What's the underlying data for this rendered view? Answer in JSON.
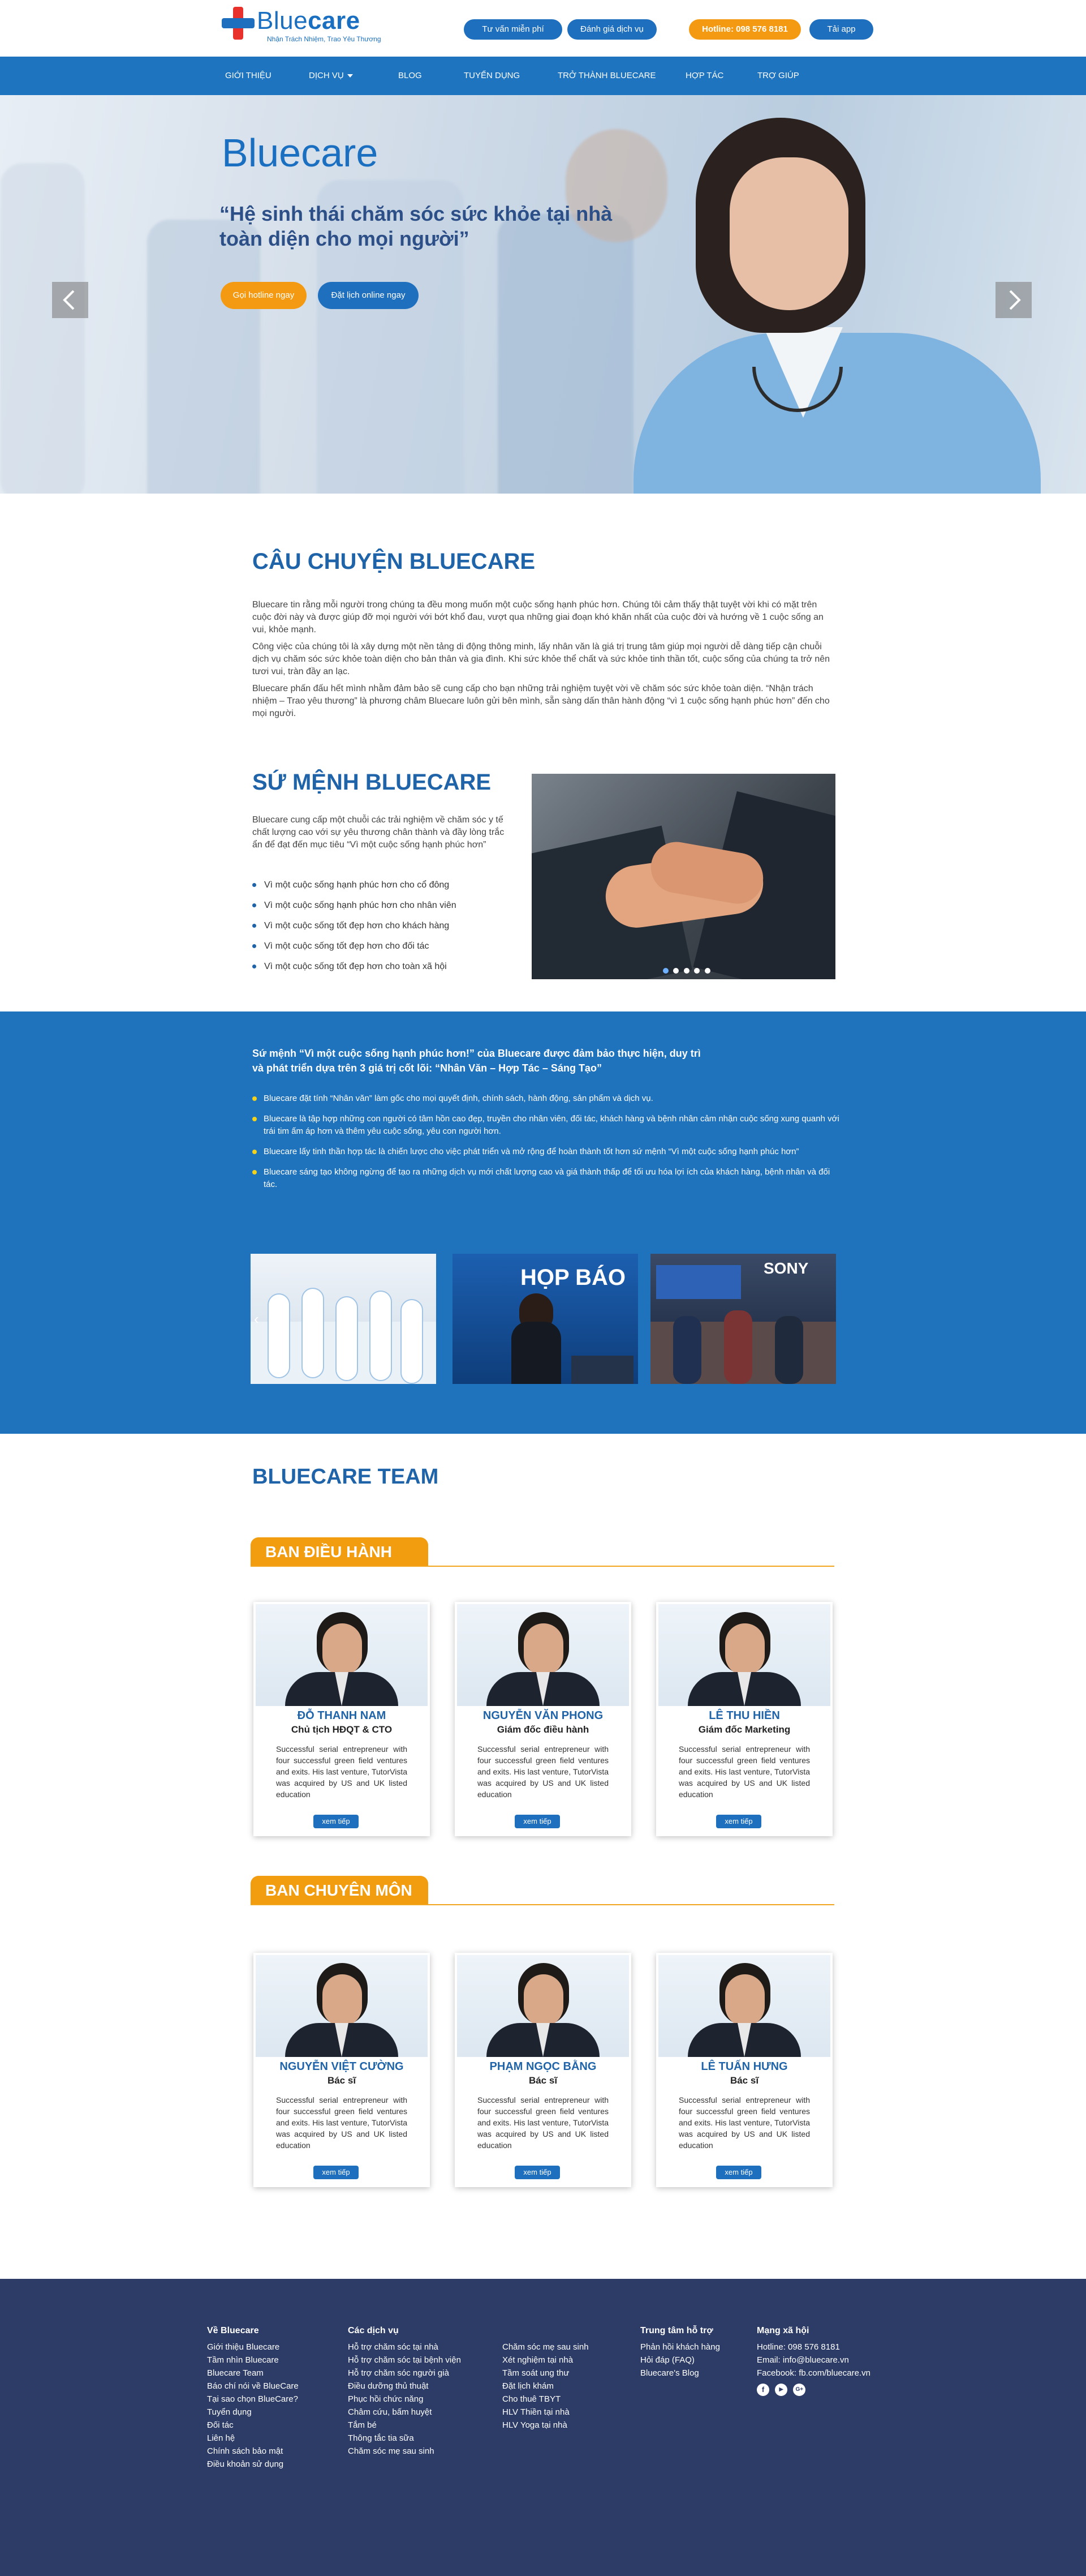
{
  "header": {
    "logo_word_light": "Blue",
    "logo_word_bold": "care",
    "tagline": "Nhận Trách Nhiệm, Trao Yêu Thương",
    "btn_consult": "Tư vấn miễn phí",
    "btn_review": "Đánh giá dịch vụ",
    "hotline": "Hotline: 098 576 8181",
    "btn_app": "Tải app"
  },
  "nav": {
    "items": [
      "GIỚI THIỆU",
      "DỊCH VỤ",
      "BLOG",
      "TUYỂN DỤNG",
      "TRỞ THÀNH BLUECARE",
      "HỢP TÁC",
      "TRỢ GIÚP"
    ]
  },
  "hero": {
    "logo": "Bluecare",
    "quote": "“Hệ sinh thái chăm sóc sức khỏe tại nhà toàn diện cho mọi người”",
    "btn_hotline": "Gọi hotline ngay",
    "btn_booking": "Đặt lịch online ngay"
  },
  "story": {
    "title": "CÂU CHUYỆN BLUECARE",
    "paragraphs": [
      "Bluecare tin rằng mỗi người trong chúng ta đều mong muốn một cuộc sống hạnh phúc hơn. Chúng tôi cảm thấy thật tuyệt vời khi có mặt trên cuộc đời này và được giúp đỡ mọi người với bớt khổ đau, vượt qua những giai đoạn khó khăn nhất của cuộc đời và hướng về 1 cuộc sống an vui, khỏe mạnh.",
      "Công việc của chúng tôi là xây dựng một nền tảng di động thông minh, lấy nhân văn là giá trị trung tâm giúp mọi người dễ dàng tiếp cận chuỗi dịch vụ chăm sóc sức khỏe toàn diện cho bản thân và gia đình. Khi sức khỏe thể chất và sức khỏe tinh thần tốt, cuộc sống của chúng ta trở nên tươi vui, tràn đầy an lạc.",
      "Bluecare phấn đấu hết mình nhằm đảm bảo sẽ cung cấp cho bạn những trải nghiệm tuyệt vời về chăm sóc sức khỏe toàn diện. “Nhận trách nhiệm – Trao yêu thương” là phương châm Bluecare luôn gửi bên mình, sẵn sàng dấn thân hành động “vì 1 cuộc sống hạnh phúc hơn” đến cho mọi người."
    ]
  },
  "mission": {
    "title": "SỨ MỆNH BLUECARE",
    "intro": "Bluecare cung cấp một chuỗi các trải nghiệm về chăm sóc y tế chất lượng cao với sự yêu thương chân thành và đầy lòng trắc ẩn để đạt đến mục tiêu “Vì một cuộc sống hạnh phúc hơn”",
    "bullets": [
      "Vì một cuộc sống hạnh phúc hơn cho cổ đông",
      "Vì một cuộc sống hạnh phúc hơn cho nhân viên",
      "Vì một cuộc sống tốt đẹp hơn cho khách hàng",
      "Vì một cuộc sống tốt đẹp hơn cho đối tác",
      "Vì một cuộc sống tốt đẹp hơn cho toàn xã hội"
    ]
  },
  "values": {
    "title_line1": "Sứ mệnh “Vì một cuộc sống hạnh phúc hơn!” của Bluecare được  đảm bảo thực hiện, duy trì",
    "title_line2": "và phát triển dựa trên 3 giá trị cốt lõi: “Nhân Văn – Hợp Tác – Sáng Tạo”",
    "bullets": [
      "Bluecare đặt tính “Nhân văn” làm gốc cho mọi quyết định, chính sách, hành động, sản phẩm và dịch vụ.",
      "Bluecare là tập hợp những con người có tâm hồn cao đẹp, truyền cho nhân viên, đối tác, khách hàng và bệnh nhân  cảm nhận cuộc sống xung quanh với trái tim ấm áp hơn và thêm yêu cuộc sống, yêu con người hơn.",
      "Bluecare lấy tinh thần hợp tác là chiến lược cho việc phát triển và mở rộng để hoàn thành tốt hơn sứ mệnh “Vì một cuộc sống hạnh phúc hơn”",
      "Bluecare sáng tạo không ngừng để tạo ra những dịch vụ mới chất lượng cao và giá thành thấp để tối ưu hóa lợi ích của khách hàng, bệnh nhân và đối tác."
    ],
    "gallery_text": [
      "HỌP BÁO",
      "SONY"
    ]
  },
  "team": {
    "title": "BLUECARE TEAM",
    "exec_title": "BAN ĐIỀU HÀNH",
    "prof_title": "BAN CHUYÊN MÔN",
    "desc": "Successful serial entrepreneur with four successful green field ventures and exits. His last venture, TutorVista was acquired by US and UK listed education",
    "more": "xem tiếp",
    "exec": [
      {
        "name": "ĐỖ THANH NAM",
        "role": "Chủ tịch HĐQT & CTO"
      },
      {
        "name": "NGUYỄN VĂN PHONG",
        "role": "Giám đốc điều hành"
      },
      {
        "name": "LÊ THU HIỀN",
        "role": "Giám đốc Marketing"
      }
    ],
    "prof": [
      {
        "name": "NGUYỄN VIỆT CƯỜNG",
        "role": "Bác sĩ"
      },
      {
        "name": "PHẠM NGỌC BẰNG",
        "role": "Bác sĩ"
      },
      {
        "name": "LÊ TUẤN HƯNG",
        "role": "Bác sĩ"
      }
    ]
  },
  "footer": {
    "about_title": "Về Bluecare",
    "about": [
      "Giới thiệu Bluecare",
      "Tầm nhìn Bluecare",
      "Bluecare Team",
      "Báo chí nói về BlueCare",
      "Tại sao chọn BlueCare?",
      "Tuyển dụng",
      "Đối tác",
      "Liên hệ",
      "Chính sách bảo mật",
      "Điều khoản sử dụng"
    ],
    "services_title": "Các dịch vụ",
    "services1": [
      "Hỗ trợ chăm sóc tại nhà",
      "Hỗ trợ chăm sóc tại bệnh viện",
      "Hỗ trợ chăm sóc người già",
      "Điều dưỡng thủ thuật",
      "Phục hồi chức năng",
      "Châm cứu, bấm huyệt",
      "Tắm bé",
      "Thông tắc tia sữa",
      "Chăm sóc mẹ sau sinh"
    ],
    "services2": [
      "Chăm sóc mẹ sau sinh",
      "Xét nghiệm tại nhà",
      "Tầm soát ung thư",
      "Đặt lịch khám",
      "Cho thuê TBYT",
      "HLV Thiền tại nhà",
      "HLV Yoga tại nhà"
    ],
    "support_title": "Trung tâm hỗ trợ",
    "support": [
      "Phản hồi khách hàng",
      "Hỏi đáp (FAQ)",
      "Bluecare's Blog"
    ],
    "social_title": "Mạng xã hội",
    "social": [
      "Hotline: 098 576 8181",
      "Email: info@bluecare.vn",
      "Facebook: fb.com/bluecare.vn"
    ],
    "social_icons": [
      "f",
      "▶",
      "G+"
    ]
  },
  "colors": {
    "brand_blue": "#1f6fbf",
    "accent_orange": "#f49a12",
    "footer_navy": "#2d3c67"
  }
}
